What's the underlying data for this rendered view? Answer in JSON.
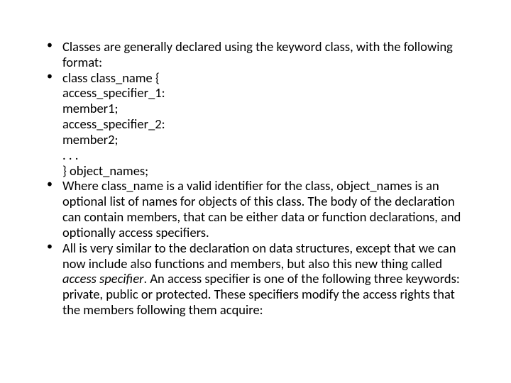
{
  "items": [
    {
      "lines": [
        "Classes are generally declared using the keyword class, with the following format:"
      ]
    },
    {
      "lines": [
        "class class_name {",
        "access_specifier_1:",
        "member1;",
        "access_specifier_2:",
        "member2;",
        ". . .",
        "} object_names;"
      ]
    },
    {
      "lines": [
        "Where class_name is a valid identifier for the class, object_names is an optional list of names for objects of this class. The body of the declaration can contain members, that can be either data or function declarations, and optionally access specifiers."
      ]
    },
    {
      "pre": "All is very similar to the declaration on data structures, except that we can now include also functions and members, but also this new thing called ",
      "em": "access specifier",
      "post": ". An access specifier is one of the following three keywords: private, public or protected. These specifiers modify the access rights that the members following them acquire:"
    }
  ]
}
